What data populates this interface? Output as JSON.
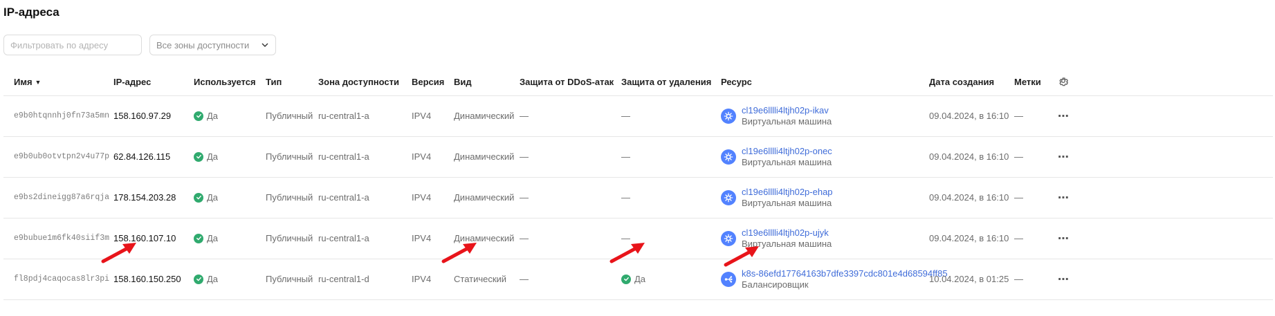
{
  "page_title": "IP-адреса",
  "filter": {
    "placeholder": "Фильтровать по адресу",
    "value": ""
  },
  "zone_select": {
    "label": "Все зоны доступности"
  },
  "table": {
    "headers": {
      "name": "Имя",
      "ip": "IP-адрес",
      "used": "Используется",
      "type": "Тип",
      "zone": "Зона доступности",
      "version": "Версия",
      "kind": "Вид",
      "ddos": "Защита от DDoS-атак",
      "deletion": "Защита от удаления",
      "resource": "Ресурс",
      "created": "Дата создания",
      "labels": "Метки"
    },
    "rows": [
      {
        "name": "e9b0htqnnhj0fn73a5mn",
        "ip": "158.160.97.29",
        "used": "Да",
        "type": "Публичный",
        "zone": "ru-central1-a",
        "version": "IPV4",
        "kind": "Динамический",
        "ddos": "—",
        "deletion": "—",
        "resource_name": "cl19e6lllli4ltjh02p-ikav",
        "resource_type": "Виртуальная машина",
        "created": "09.04.2024, в 16:10",
        "labels": "—"
      },
      {
        "name": "e9b0ub0otvtpn2v4u77p",
        "ip": "62.84.126.115",
        "used": "Да",
        "type": "Публичный",
        "zone": "ru-central1-a",
        "version": "IPV4",
        "kind": "Динамический",
        "ddos": "—",
        "deletion": "—",
        "resource_name": "cl19e6lllli4ltjh02p-onec",
        "resource_type": "Виртуальная машина",
        "created": "09.04.2024, в 16:10",
        "labels": "—"
      },
      {
        "name": "e9bs2dineigg87a6rqja",
        "ip": "178.154.203.28",
        "used": "Да",
        "type": "Публичный",
        "zone": "ru-central1-a",
        "version": "IPV4",
        "kind": "Динамический",
        "ddos": "—",
        "deletion": "—",
        "resource_name": "cl19e6lllli4ltjh02p-ehap",
        "resource_type": "Виртуальная машина",
        "created": "09.04.2024, в 16:10",
        "labels": "—"
      },
      {
        "name": "e9bubue1m6fk40siif3m",
        "ip": "158.160.107.10",
        "used": "Да",
        "type": "Публичный",
        "zone": "ru-central1-a",
        "version": "IPV4",
        "kind": "Динамический",
        "ddos": "—",
        "deletion": "—",
        "resource_name": "cl19e6lllli4ltjh02p-ujyk",
        "resource_type": "Виртуальная машина",
        "created": "09.04.2024, в 16:10",
        "labels": "—"
      },
      {
        "name": "fl8pdj4caqocas8lr3pi",
        "ip": "158.160.150.250",
        "used": "Да",
        "type": "Публичный",
        "zone": "ru-central1-d",
        "version": "IPV4",
        "kind": "Статический",
        "ddos": "—",
        "deletion": "Да",
        "resource_name": "k8s-86efd17764163b7dfe3397cdc801e4d68594ff85",
        "resource_type": "Балансировщик",
        "created": "10.04.2024, в 01:25",
        "labels": "—"
      }
    ]
  },
  "colors": {
    "accent": "#3f6cd9",
    "success": "#30aa6e",
    "resource_icon": "#5282ff",
    "annotation_arrow": "#e8141a"
  }
}
